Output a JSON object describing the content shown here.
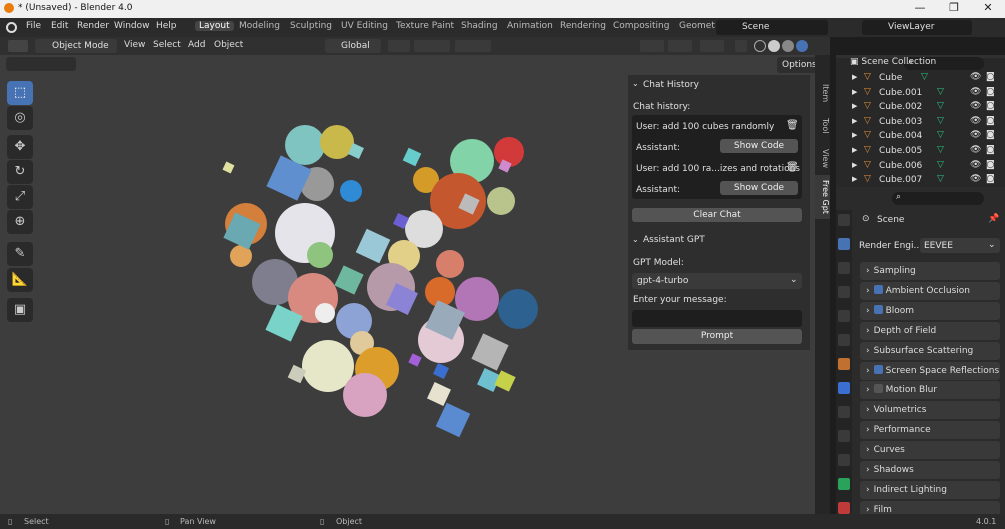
{
  "window": {
    "title": "* (Unsaved) - Blender 4.0",
    "minimize": "—",
    "maximize": "❐",
    "close": "✕"
  },
  "menu": {
    "items": [
      "File",
      "Edit",
      "Render",
      "Window",
      "Help"
    ]
  },
  "workspaces": [
    "Layout",
    "Modeling",
    "Sculpting",
    "UV Editing",
    "Texture Paint",
    "Shading",
    "Animation",
    "Rendering",
    "Compositing",
    "Geomet"
  ],
  "scene_selector": {
    "value": "Scene"
  },
  "viewlayer_selector": {
    "value": "ViewLayer"
  },
  "viewport_header": {
    "mode": "Object Mode",
    "menus": [
      "View",
      "Select",
      "Add",
      "Object"
    ],
    "orientation": "Global",
    "options": "Options"
  },
  "npanel": {
    "tabs": [
      "Item",
      "Tool",
      "View",
      "Free Gpt"
    ],
    "chat_history_title": "Chat History",
    "chat_history_label": "Chat history:",
    "messages": [
      {
        "user": "User: add 100 cubes randomly",
        "assistant": "Assistant:",
        "show_code": "Show Code"
      },
      {
        "user": "User: add 100 ra...izes and rotations",
        "assistant": "Assistant:",
        "show_code": "Show Code"
      }
    ],
    "clear_chat": "Clear Chat",
    "assistant_title": "Assistant GPT",
    "gpt_model_label": "GPT Model:",
    "gpt_model_value": "gpt-4-turbo",
    "message_label": "Enter your message:",
    "message_value": "",
    "prompt_button": "Prompt"
  },
  "outliner": {
    "collection": "Scene Collection",
    "items": [
      "Cube",
      "Cube.001",
      "Cube.002",
      "Cube.003",
      "Cube.004",
      "Cube.005",
      "Cube.006",
      "Cube.007"
    ]
  },
  "properties": {
    "scene": "Scene",
    "render_engine_label": "Render Engi...",
    "render_engine_value": "EEVEE",
    "sections": [
      {
        "label": "Sampling",
        "checkbox": null
      },
      {
        "label": "Ambient Occlusion",
        "checkbox": true
      },
      {
        "label": "Bloom",
        "checkbox": true
      },
      {
        "label": "Depth of Field",
        "checkbox": null
      },
      {
        "label": "Subsurface Scattering",
        "checkbox": null
      },
      {
        "label": "Screen Space Reflections",
        "checkbox": true
      },
      {
        "label": "Motion Blur",
        "checkbox": false
      },
      {
        "label": "Volumetrics",
        "checkbox": null
      },
      {
        "label": "Performance",
        "checkbox": null
      },
      {
        "label": "Curves",
        "checkbox": null
      },
      {
        "label": "Shadows",
        "checkbox": null
      },
      {
        "label": "Indirect Lighting",
        "checkbox": null
      },
      {
        "label": "Film",
        "checkbox": null
      }
    ]
  },
  "statusbar": {
    "select": "Select",
    "pan": "Pan View",
    "object": "Object",
    "version": "4.0.1"
  },
  "colors": {
    "accent": "#4772b3",
    "viewport_bg": "#3d3d3d",
    "panel_bg": "#2e2e2e"
  }
}
